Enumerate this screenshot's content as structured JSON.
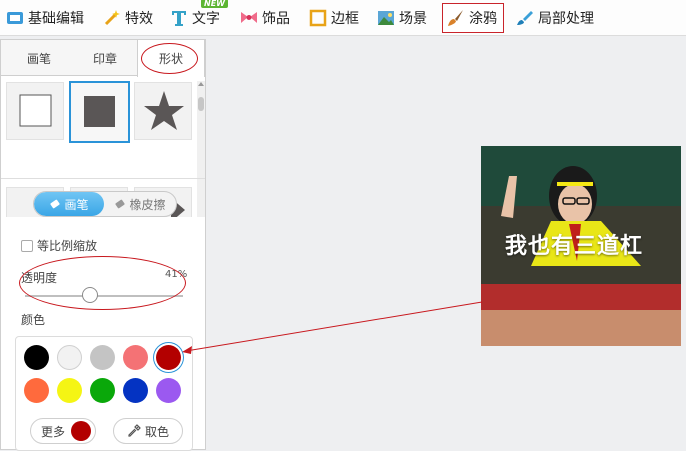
{
  "toolbar": {
    "items": [
      {
        "label": "基础编辑"
      },
      {
        "label": "特效"
      },
      {
        "label": "文字",
        "badge": "NEW"
      },
      {
        "label": "饰品"
      },
      {
        "label": "边框"
      },
      {
        "label": "场景"
      },
      {
        "label": "涂鸦"
      },
      {
        "label": "局部处理"
      }
    ],
    "active_index": 6
  },
  "panel": {
    "tabs": [
      "画笔",
      "印章",
      "形状"
    ],
    "active_tab": "形状",
    "shapes": [
      {
        "icon": "square-outline-icon"
      },
      {
        "icon": "square-filled-icon"
      },
      {
        "icon": "star-icon"
      },
      {
        "icon": "arrow-icon"
      },
      {
        "icon": "arrow-icon"
      },
      {
        "icon": "arrow-icon"
      }
    ],
    "selected_shape": 1,
    "mode": {
      "brush": "画笔",
      "eraser": "橡皮擦",
      "active": "brush"
    },
    "proportional_label": "等比例缩放",
    "proportional_checked": false,
    "opacity_label": "透明度",
    "opacity_value": "41%",
    "opacity_level": 0.41,
    "color_label": "颜色",
    "colors": [
      "#000000",
      "#f2f2f2",
      "#c4c4c4",
      "#f47275",
      "#b30000",
      "#ff6a3d",
      "#f5f514",
      "#0aa80a",
      "#0433c2",
      "#9b59f0"
    ],
    "selected_color_index": 4,
    "more_label": "更多",
    "more_color": "#b30000",
    "pick_label": "取色"
  },
  "canvas": {
    "caption": "我也有三道杠"
  },
  "annotation_color": "#c8181e"
}
